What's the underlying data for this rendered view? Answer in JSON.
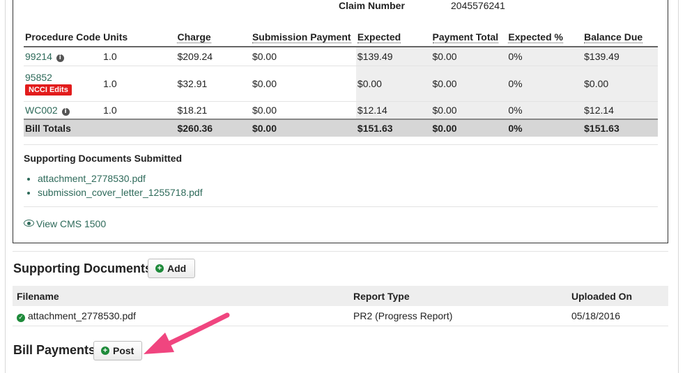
{
  "claim": {
    "label": "Claim Number",
    "value": "2045576241"
  },
  "procedures": {
    "headers": [
      "Procedure Code",
      "Units",
      "Charge",
      "Submission Payment",
      "Expected",
      "Payment Total",
      "Expected %",
      "Balance Due"
    ],
    "rows": [
      {
        "code": "99214",
        "badge": "",
        "units": "1.0",
        "charge": "$209.24",
        "submission": "$0.00",
        "expected": "$139.49",
        "payment": "$0.00",
        "pct": "0%",
        "balance": "$139.49"
      },
      {
        "code": "95852",
        "badge": "NCCI Edits",
        "units": "1.0",
        "charge": "$32.91",
        "submission": "$0.00",
        "expected": "$0.00",
        "payment": "$0.00",
        "pct": "0%",
        "balance": "$0.00"
      },
      {
        "code": "WC002",
        "badge": "",
        "units": "1.0",
        "charge": "$18.21",
        "submission": "$0.00",
        "expected": "$12.14",
        "payment": "$0.00",
        "pct": "0%",
        "balance": "$12.14"
      }
    ],
    "totals": {
      "label": "Bill Totals",
      "charge": "$260.36",
      "submission": "$0.00",
      "expected": "$151.63",
      "payment": "$0.00",
      "pct": "0%",
      "balance": "$151.63"
    }
  },
  "supporting_submitted": {
    "title": "Supporting Documents Submitted",
    "files": [
      "attachment_2778530.pdf",
      "submission_cover_letter_1255718.pdf"
    ],
    "view_link": "View CMS 1500"
  },
  "supporting_docs": {
    "title": "Supporting Documents",
    "add_label": "Add",
    "headers": [
      "Filename",
      "Report Type",
      "Uploaded On"
    ],
    "rows": [
      {
        "filename": "attachment_2778530.pdf",
        "report_type": "PR2 (Progress Report)",
        "uploaded": "05/18/2016"
      }
    ]
  },
  "bill_payments": {
    "title": "Bill Payments",
    "post_label": "Post"
  },
  "icons": {
    "info": "info-icon",
    "eye": "eye-icon",
    "plus": "plus-circle-icon",
    "check": "check-circle-icon",
    "arrow": "pink-arrow-annotation"
  },
  "colors": {
    "link": "#2e6a5a",
    "badge": "#e21c1c",
    "success": "#1e8a3a",
    "annotation": "#f0457f"
  }
}
